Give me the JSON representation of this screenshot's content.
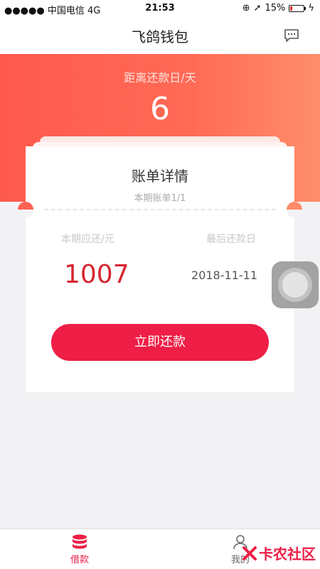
{
  "status_bar": {
    "carrier": "●●●●● 中国电信  4G",
    "time": "21:53",
    "battery": "15%",
    "battery_level": 0.15
  },
  "nav": {
    "title": "飞鸽钱包",
    "message_icon": "chat-bubble-icon"
  },
  "hero": {
    "label": "距离还款日/天",
    "days": "6"
  },
  "card": {
    "title": "账单详情",
    "subtitle": "本期账单1/1",
    "amount_label": "本期应还/元",
    "amount": "1007",
    "due_label": "最后还款日",
    "due_date": "2018-11-11",
    "repay_button": "立即还款"
  },
  "tabs": [
    {
      "label": "借款",
      "icon": "database-icon",
      "active": true
    },
    {
      "label": "我的",
      "icon": "user-icon",
      "active": false
    }
  ],
  "watermark": {
    "text": "卡农社区"
  },
  "colors": {
    "accent": "#ee1e46",
    "hero_start": "#ff5a4e",
    "hero_end": "#ff8e6c",
    "amount": "#d8252f"
  }
}
